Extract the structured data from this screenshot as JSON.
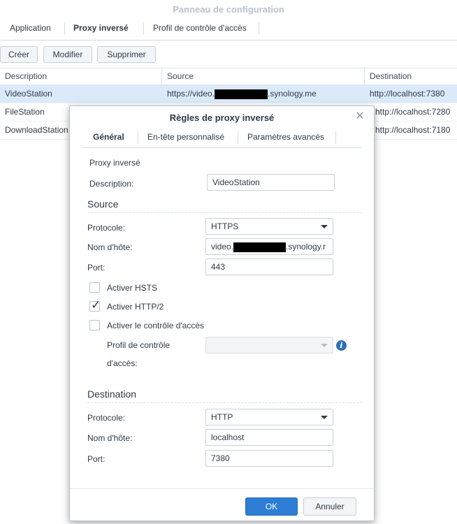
{
  "window": {
    "title": "Panneau de configuration"
  },
  "tabs": [
    "Application",
    "Proxy inversé",
    "Profil de contrôle d'accès"
  ],
  "toolbar": {
    "create": "Créer",
    "modify": "Modifier",
    "delete": "Supprimer"
  },
  "grid": {
    "columns": [
      "Description",
      "Source",
      "Destination"
    ],
    "rows": [
      {
        "description": "VideoStation",
        "source_prefix": "https://video.",
        "source_suffix": ".synology.me",
        "destination": "http://localhost:7380",
        "selected": true
      },
      {
        "description": "FileStation",
        "destination": "http://localhost:7280"
      },
      {
        "description": "DownloadStation",
        "destination": "http://localhost:7180"
      }
    ]
  },
  "dialog": {
    "title": "Règles de proxy inversé",
    "tabs": [
      "Général",
      "En-tête personnalisé",
      "Paramètres avancés"
    ],
    "group_label": "Proxy inversé",
    "description_label": "Description:",
    "description_value": "VideoStation",
    "source": {
      "heading": "Source",
      "protocol_label": "Protocole:",
      "protocol_value": "HTTPS",
      "hostname_label": "Nom d'hôte:",
      "hostname_prefix": "video.",
      "hostname_suffix": ".synology.r",
      "port_label": "Port:",
      "port_value": "443",
      "hsts_label": "Activer HSTS",
      "hsts_checked": false,
      "http2_label": "Activer HTTP/2",
      "http2_checked": true,
      "access_label": "Activer le contrôle d'accès",
      "access_checked": false,
      "profile_label_1": "Profil de contrôle",
      "profile_label_2": "d'accès:",
      "profile_value": ""
    },
    "destination": {
      "heading": "Destination",
      "protocol_label": "Protocole:",
      "protocol_value": "HTTP",
      "hostname_label": "Nom d'hôte:",
      "hostname_value": "localhost",
      "port_label": "Port:",
      "port_value": "7380"
    },
    "buttons": {
      "ok": "OK",
      "cancel": "Annuler"
    }
  },
  "icons": {
    "close": "close-icon",
    "info": "info-icon",
    "dropdown": "chevron-down-icon",
    "check": "checkmark-icon"
  },
  "colors": {
    "accent": "#2d7ed4",
    "selected_row": "#dbeaf9",
    "info": "#2f6fb7"
  }
}
